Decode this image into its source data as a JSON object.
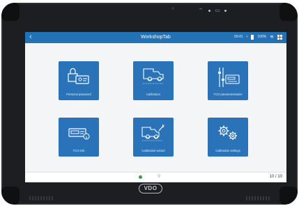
{
  "app": {
    "title": "WorkshopTab",
    "status_time": "09:41",
    "battery": "100%"
  },
  "tiles": [
    {
      "label": "Personal password",
      "icon": "lock-card-icon"
    },
    {
      "label": "Calibration",
      "icon": "truck-sensor-icon"
    },
    {
      "label": "TCO parameterisation",
      "icon": "sliders-device-icon"
    },
    {
      "label": "TCO info",
      "icon": "tachograph-info-icon"
    },
    {
      "label": "Calibration wizard",
      "icon": "truck-wand-icon"
    },
    {
      "label": "Calibration settings",
      "icon": "gears-icon"
    }
  ],
  "footer": {
    "page_indicator": "10 / 10"
  },
  "brand": {
    "logo_text": "VDO"
  },
  "colors": {
    "accent": "#2a73b8",
    "topbar": "#2272b5",
    "device_frame": "#1c1e22"
  }
}
